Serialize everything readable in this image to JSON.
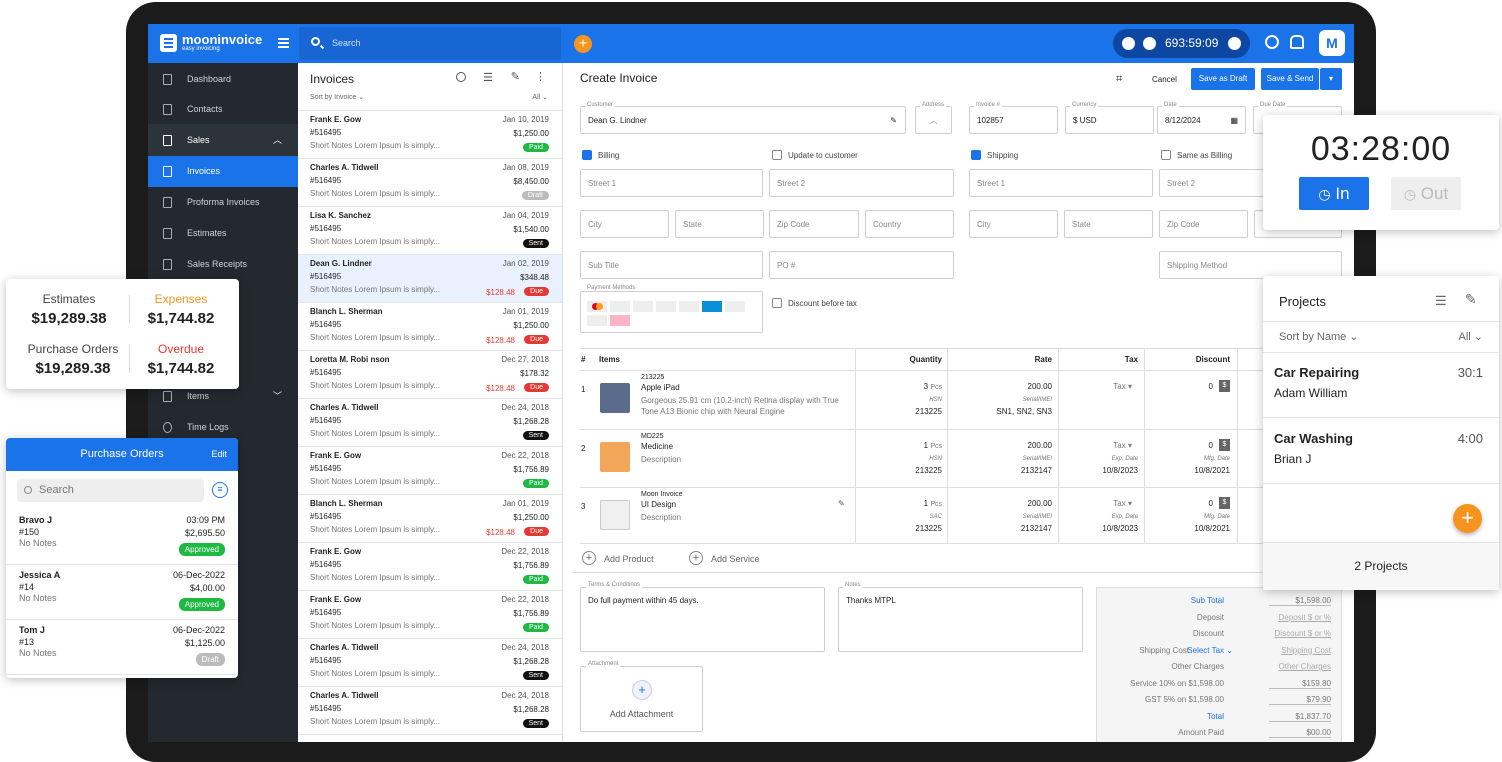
{
  "app": {
    "logo": "mooninvoice",
    "tagline": "easy invoicing",
    "search_placeholder": "Search",
    "timer": "693:59:09",
    "avatar": "M"
  },
  "sidebar": {
    "items": [
      {
        "label": "Dashboard"
      },
      {
        "label": "Contacts"
      },
      {
        "label": "Sales"
      },
      {
        "label": "Invoices"
      },
      {
        "label": "Proforma Invoices"
      },
      {
        "label": "Estimates"
      },
      {
        "label": "Sales Receipts"
      },
      {
        "label": "Items"
      },
      {
        "label": "Time Logs"
      }
    ]
  },
  "invoices": {
    "title": "Invoices",
    "sort": "Sort by Invoice",
    "filter": "All",
    "rows": [
      {
        "name": "Frank E. Gow",
        "date": "Jan 10, 2019",
        "num": "#516495",
        "amount": "$1,250.00",
        "note": "Short Notes Lorem Ipsum is simply...",
        "status": "Paid",
        "due": ""
      },
      {
        "name": "Charles A. Tidwell",
        "date": "Jan 08, 2019",
        "num": "#516495",
        "amount": "$8,450.00",
        "note": "Short Notes Lorem Ipsum is simply...",
        "status": "Draft",
        "due": ""
      },
      {
        "name": "Lisa K. Sanchez",
        "date": "Jan 04, 2019",
        "num": "#516495",
        "amount": "$1,540.00",
        "note": "Short Notes Lorem Ipsum is simply...",
        "status": "Sent",
        "due": ""
      },
      {
        "name": "Dean G. Lindner",
        "date": "Jan 02, 2019",
        "num": "#516495",
        "amount": "$348.48",
        "note": "Short Notes Lorem Ipsum is simply...",
        "status": "Due",
        "due": "$128.48"
      },
      {
        "name": "Blanch L. Sherman",
        "date": "Jan 01, 2019",
        "num": "#516495",
        "amount": "$1,250.00",
        "note": "Short Notes Lorem Ipsum is simply...",
        "status": "Due",
        "due": "$128.48"
      },
      {
        "name": "Loretta M. Robi  nson",
        "date": "Dec 27, 2018",
        "num": "#516495",
        "amount": "$178.32",
        "note": "Short Notes Lorem Ipsum is simply...",
        "status": "Due",
        "due": "$128.48"
      },
      {
        "name": "Charles A. Tidwell",
        "date": "Dec 24, 2018",
        "num": "#516495",
        "amount": "$1,268.28",
        "note": "Short Notes Lorem Ipsum is simply...",
        "status": "Sent",
        "due": ""
      },
      {
        "name": "Frank E. Gow",
        "date": "Dec 22, 2018",
        "num": "#516495",
        "amount": "$1,756.89",
        "note": "Short Notes Lorem Ipsum is simply...",
        "status": "Paid",
        "due": ""
      },
      {
        "name": "Blanch L. Sherman",
        "date": "Jan 01, 2019",
        "num": "#516495",
        "amount": "$1,250.00",
        "note": "Short Notes Lorem Ipsum is simply...",
        "status": "Due",
        "due": "$128.48"
      },
      {
        "name": "Frank E. Gow",
        "date": "Dec 22, 2018",
        "num": "#516495",
        "amount": "$1,756.89",
        "note": "Short Notes Lorem Ipsum is simply...",
        "status": "Paid",
        "due": ""
      },
      {
        "name": "Frank E. Gow",
        "date": "Dec 22, 2018",
        "num": "#516495",
        "amount": "$1,756.89",
        "note": "Short Notes Lorem Ipsum is simply...",
        "status": "Paid",
        "due": ""
      },
      {
        "name": "Charles A. Tidwell",
        "date": "Dec 24, 2018",
        "num": "#516495",
        "amount": "$1,268.28",
        "note": "Short Notes Lorem Ipsum is simply...",
        "status": "Sent",
        "due": ""
      },
      {
        "name": "Charles A. Tidwell",
        "date": "Dec 24, 2018",
        "num": "#516495",
        "amount": "$1,268.28",
        "note": "Short Notes Lorem Ipsum is simply...",
        "status": "Sent",
        "due": ""
      }
    ]
  },
  "create": {
    "title": "Create Invoice",
    "cancel": "Cancel",
    "save_draft": "Save as Draft",
    "save_send": "Save & Send",
    "customer_label": "Customer",
    "customer": "Dean G. Lindner",
    "address_label": "Address",
    "invoice_label": "Invoice #",
    "invoice_no": "102857",
    "currency_label": "Currency",
    "currency": "$ USD",
    "date_label": "Date",
    "date": "8/12/2024",
    "due_label": "Due Date",
    "billing": "Billing",
    "update_customer": "Update to customer",
    "shipping": "Shipping",
    "same_billing": "Same as Billing",
    "street1": "Street 1",
    "street2": "Street 2",
    "city": "City",
    "state": "State",
    "zip": "Zip Code",
    "country": "Country",
    "subtitle": "Sub Title",
    "po": "PO #",
    "shipping_method": "Shipping Method",
    "payment_methods": "Payment Methods",
    "discount_before_tax": "Discount before tax",
    "cols": {
      "no": "#",
      "items": "Items",
      "qty": "Quantity",
      "rate": "Rate",
      "tax": "Tax",
      "discount": "Discount"
    },
    "lines": [
      {
        "no": "1",
        "code": "213225",
        "name": "Apple iPad",
        "desc": "Gorgeous 25.91 cm (10.2-inch) Retina display with True Tone A13 Bionic chip with Neural Engine",
        "qty": "3",
        "unit": "Pcs",
        "code_lbl": "HSN",
        "code_val": "213225",
        "rate": "200.00",
        "serial_lbl": "Serial/IMEI",
        "serial": "SN1, SN2, SN3",
        "tax": "Tax",
        "exp_lbl": "",
        "exp": "",
        "disc": "0",
        "mfg_lbl": "",
        "mfg": ""
      },
      {
        "no": "2",
        "code": "MD225",
        "name": "Medicine",
        "desc": "Description",
        "qty": "1",
        "unit": "Pcs",
        "code_lbl": "HSN",
        "code_val": "213225",
        "rate": "200.00",
        "serial_lbl": "Serial/IMEI",
        "serial": "2132147",
        "tax": "Tax",
        "exp_lbl": "Exp. Date",
        "exp": "10/8/2023",
        "disc": "0",
        "mfg_lbl": "Mfg. Date",
        "mfg": "10/8/2021"
      },
      {
        "no": "3",
        "code": "Moon Invoice",
        "name": "UI Design",
        "desc": "Description",
        "qty": "1",
        "unit": "Pcs",
        "code_lbl": "SAC",
        "code_val": "213225",
        "rate": "200.00",
        "serial_lbl": "Serial/IMEI",
        "serial": "2132147",
        "tax": "Tax",
        "exp_lbl": "Exp. Date",
        "exp": "10/8/2023",
        "disc": "0",
        "mfg_lbl": "Mfg. Date",
        "mfg": "10/8/2021"
      }
    ],
    "add_product": "Add Product",
    "add_service": "Add Service",
    "terms_label": "Terms & Conditinos",
    "terms": "Do full payment within 45 days.",
    "notes_label": "Notes",
    "notes": "Thanks MTPL",
    "attachment_label": "Attachment",
    "add_attachment": "Add Attachment",
    "summary": [
      {
        "label": "Sub Total",
        "value": "$1,598.00"
      },
      {
        "label": "Deposit",
        "value": "Deposit $ or %"
      },
      {
        "label": "Discount",
        "value": "Discount $ or %"
      },
      {
        "label": "Shipping Cost",
        "extra": "Select Tax",
        "value": "Shipping Cost"
      },
      {
        "label": "Other Charges",
        "value": "Other Charges"
      },
      {
        "label": "Service 10% on $1,598.00",
        "value": "$159.80"
      },
      {
        "label": "GST 5% on $1,598.00",
        "value": "$79.90"
      },
      {
        "label": "Total",
        "value": "$1,837.70"
      },
      {
        "label": "Amount Paid",
        "value": "$00.00"
      }
    ]
  },
  "stats": {
    "estimates_l": "Estimates",
    "estimates_v": "$19,289.38",
    "expenses_l": "Expenses",
    "expenses_v": "$1,744.82",
    "po_l": "Purchase Orders",
    "po_v": "$19,289.38",
    "overdue_l": "Overdue",
    "overdue_v": "$1,744.82"
  },
  "purchase_orders": {
    "title": "Purchase Orders",
    "edit": "Edit",
    "search": "Search",
    "items": [
      {
        "name": "Bravo J",
        "time": "03:09 PM",
        "num": "#150",
        "amount": "$2,695.50",
        "note": "No Notes",
        "status": "Approved"
      },
      {
        "name": "Jessica A",
        "time": "06-Dec-2022",
        "num": "#14",
        "amount": "$4,00.00",
        "note": "No Notes",
        "status": "Approved"
      },
      {
        "name": "Tom J",
        "time": "06-Dec-2022",
        "num": "#13",
        "amount": "$1,125.00",
        "note": "No Notes",
        "status": "Draft"
      }
    ]
  },
  "clock": {
    "time": "03:28:00",
    "in": "In",
    "out": "Out"
  },
  "projects": {
    "title": "Projects",
    "sort": "Sort by Name",
    "filter": "All",
    "count": "2 Projects",
    "items": [
      {
        "name": "Car Repairing",
        "time": "30:1",
        "person": "Adam William"
      },
      {
        "name": "Car Washing",
        "time": "4:00",
        "person": "Brian J"
      }
    ]
  },
  "colors": {
    "primary": "#1a73e8",
    "sidebar": "#23292f",
    "paid": "#1db940",
    "draft": "#bbbbbb",
    "due": "#e53935",
    "sent": "#111111",
    "accent": "#f7941d"
  }
}
